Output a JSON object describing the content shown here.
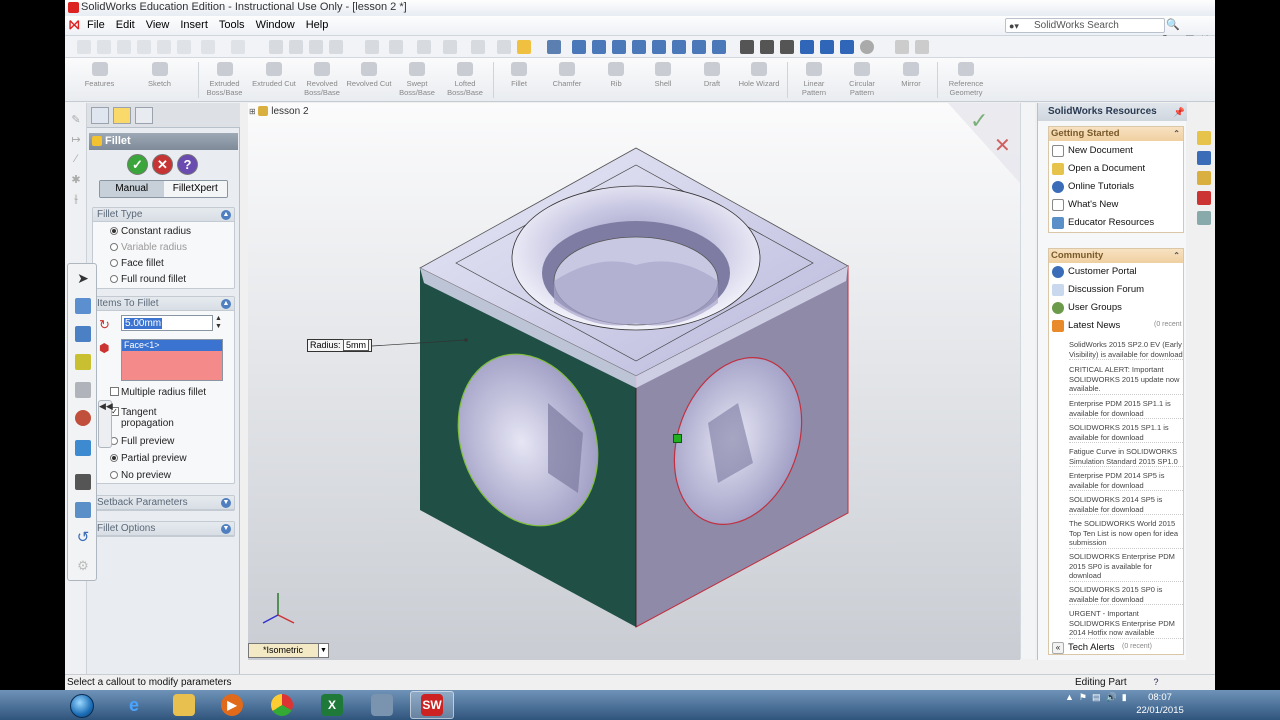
{
  "window": {
    "title": "SolidWorks Education Edition - Instructional Use Only - [lesson 2 *]",
    "menus": [
      "File",
      "Edit",
      "View",
      "Insert",
      "Tools",
      "Window",
      "Help"
    ],
    "search_placeholder": "SolidWorks Search"
  },
  "command_manager": {
    "features_tab": "Features",
    "sketch_tab": "Sketch",
    "items": [
      {
        "label": "Extruded Boss/Base",
        "icon": "extrude-boss-icon"
      },
      {
        "label": "Extruded Cut",
        "icon": "extrude-cut-icon"
      },
      {
        "label": "Revolved Boss/Base",
        "icon": "revolve-boss-icon"
      },
      {
        "label": "Revolved Cut",
        "icon": "revolve-cut-icon"
      },
      {
        "label": "Swept Boss/Base",
        "icon": "swept-boss-icon"
      },
      {
        "label": "Lofted Boss/Base",
        "icon": "loft-boss-icon"
      },
      {
        "label": "Fillet",
        "icon": "fillet-icon"
      },
      {
        "label": "Chamfer",
        "icon": "chamfer-icon"
      },
      {
        "label": "Rib",
        "icon": "rib-icon"
      },
      {
        "label": "Shell",
        "icon": "shell-icon"
      },
      {
        "label": "Draft",
        "icon": "draft-icon"
      },
      {
        "label": "Hole Wizard",
        "icon": "hole-wizard-icon"
      },
      {
        "label": "Linear Pattern",
        "icon": "linear-pattern-icon"
      },
      {
        "label": "Circular Pattern",
        "icon": "circular-pattern-icon"
      },
      {
        "label": "Mirror",
        "icon": "mirror-icon"
      },
      {
        "label": "Reference Geometry",
        "icon": "reference-geometry-icon"
      }
    ]
  },
  "fillet_panel": {
    "title": "Fillet",
    "mode_manual": "Manual",
    "mode_xpert": "FilletXpert",
    "fillet_type_header": "Fillet Type",
    "fillet_types": [
      {
        "label": "Constant radius",
        "selected": true,
        "enabled": true
      },
      {
        "label": "Variable radius",
        "selected": false,
        "enabled": false
      },
      {
        "label": "Face fillet",
        "selected": false,
        "enabled": true
      },
      {
        "label": "Full round fillet",
        "selected": false,
        "enabled": true
      }
    ],
    "items_header": "Items To Fillet",
    "radius_value": "5.00mm",
    "selected_item": "Face<1>",
    "multiple_radius": "Multiple radius fillet",
    "tangent_line1": "Tangent",
    "tangent_line2": "propagation",
    "previews": [
      {
        "label": "Full preview",
        "selected": false
      },
      {
        "label": "Partial preview",
        "selected": true
      },
      {
        "label": "No preview",
        "selected": false
      }
    ],
    "setback_header": "Setback Parameters",
    "options_header": "Fillet Options"
  },
  "viewport": {
    "tree_label": "lesson 2",
    "callout_label": "Radius:",
    "callout_value": "5mm",
    "view_orientation": "*Isometric",
    "face_colors": {
      "left": "#1f4f45",
      "right": "#8e8aa8",
      "top": "#c8c8e6"
    }
  },
  "resources": {
    "title": "SolidWorks Resources",
    "getting_started_header": "Getting Started",
    "getting_started": [
      "New Document",
      "Open a Document",
      "Online Tutorials",
      "What's New",
      "Educator Resources"
    ],
    "community_header": "Community",
    "community": [
      "Customer Portal",
      "Discussion Forum",
      "User Groups"
    ],
    "latest_news": "Latest News",
    "latest_news_count": "(0 recent",
    "news": [
      "SolidWorks 2015 SP2.0 EV (Early Visibility) is available for download",
      "CRITICAL ALERT: Important SOLIDWORKS 2015 update now available.",
      "Enterprise PDM 2015 SP1.1 is available for download",
      "SOLIDWORKS 2015 SP1.1 is available for download",
      "Fatigue Curve in SOLIDWORKS Simulation Standard 2015 SP1.0",
      "Enterprise PDM 2014 SP5 is available for download",
      "SOLIDWORKS 2014 SP5 is available for download",
      "The SOLIDWORKS World 2015 Top Ten List is now open for idea submission",
      "SOLIDWORKS Enterprise PDM 2015 SP0 is available for download",
      "SOLIDWORKS 2015 SP0 is available for download",
      "URGENT - Important SOLIDWORKS Enterprise PDM 2014 Hotfix now available"
    ],
    "tech_alerts": "Tech Alerts",
    "tech_alerts_count": "(0 recent)"
  },
  "status": {
    "message": "Select a callout to modify parameters",
    "mode": "Editing Part",
    "help": "?"
  },
  "taskbar": {
    "time": "08:07",
    "date": "22/01/2015"
  }
}
